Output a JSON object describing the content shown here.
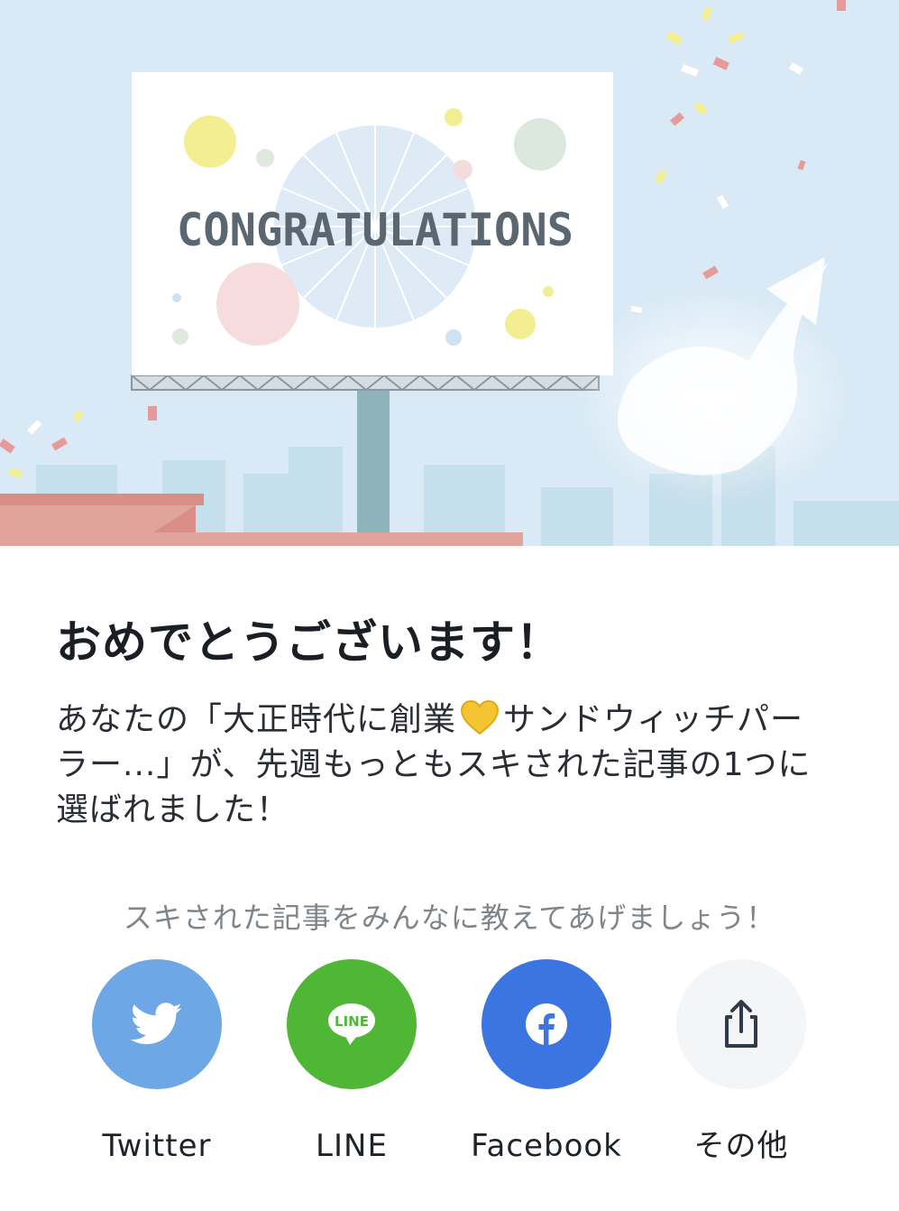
{
  "hero": {
    "billboard_text": "CONGRATULATIONS",
    "colors": {
      "sky": "#d9eaf6",
      "billboard": "#ffffff",
      "billboard_text": "#5a6670",
      "roof": "#e0a49d"
    }
  },
  "heading": "おめでとうございます！",
  "message": {
    "before_heart": "あなたの「大正時代に創業",
    "heart_icon": "yellow-heart-emoji",
    "after_heart": "サンドウィッチパーラー...」が、先週もっともスキされた記事の1つに選ばれました！"
  },
  "share": {
    "prompt": "スキされた記事をみんなに教えてあげましょう！",
    "buttons": [
      {
        "label": "Twitter",
        "icon": "twitter-bird-icon",
        "color": "#6da7e6"
      },
      {
        "label": "LINE",
        "icon": "line-icon",
        "icon_text": "LINE",
        "color": "#4fb735"
      },
      {
        "label": "Facebook",
        "icon": "facebook-icon",
        "color": "#3b75e2"
      },
      {
        "label": "その他",
        "icon": "share-icon",
        "color": "#f4f5f6"
      }
    ]
  }
}
